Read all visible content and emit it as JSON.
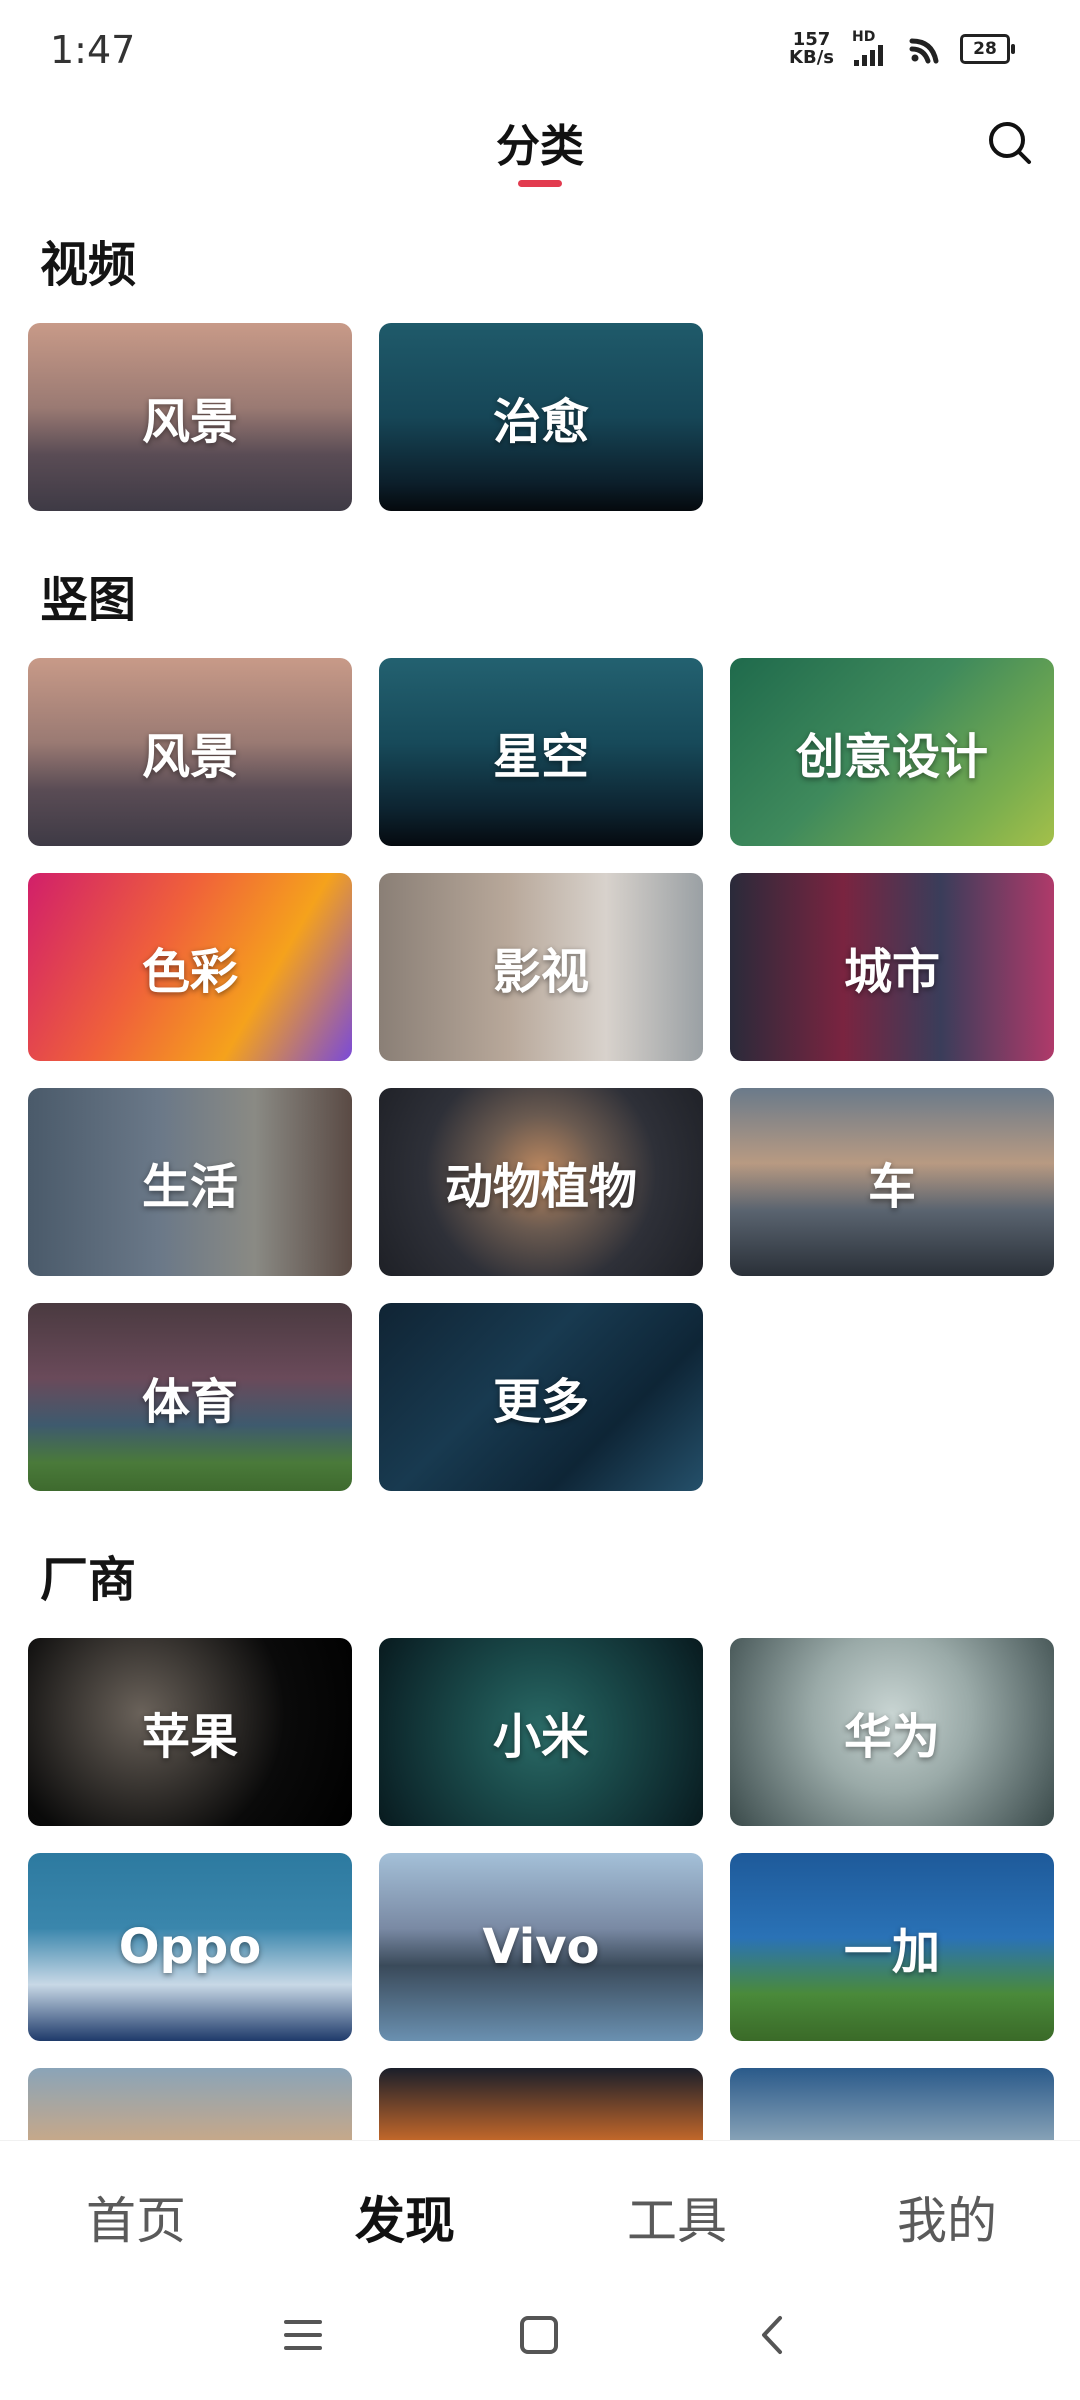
{
  "status": {
    "time": "1:47",
    "speed_top": "157",
    "speed_bottom": "KB/s",
    "hd": "HD",
    "battery": "28"
  },
  "header": {
    "title": "分类"
  },
  "sections": {
    "video": {
      "title": "视频",
      "tiles": [
        "风景",
        "治愈"
      ]
    },
    "portrait": {
      "title": "竖图",
      "tiles": [
        "风景",
        "星空",
        "创意设计",
        "色彩",
        "影视",
        "城市",
        "生活",
        "动物植物",
        "车",
        "体育",
        "更多"
      ]
    },
    "vendors": {
      "title": "厂商",
      "tiles": [
        "苹果",
        "小米",
        "华为",
        "Oppo",
        "Vivo",
        "一加"
      ]
    }
  },
  "bottom_nav": {
    "items": [
      "首页",
      "发现",
      "工具",
      "我的"
    ],
    "active": "发现"
  }
}
